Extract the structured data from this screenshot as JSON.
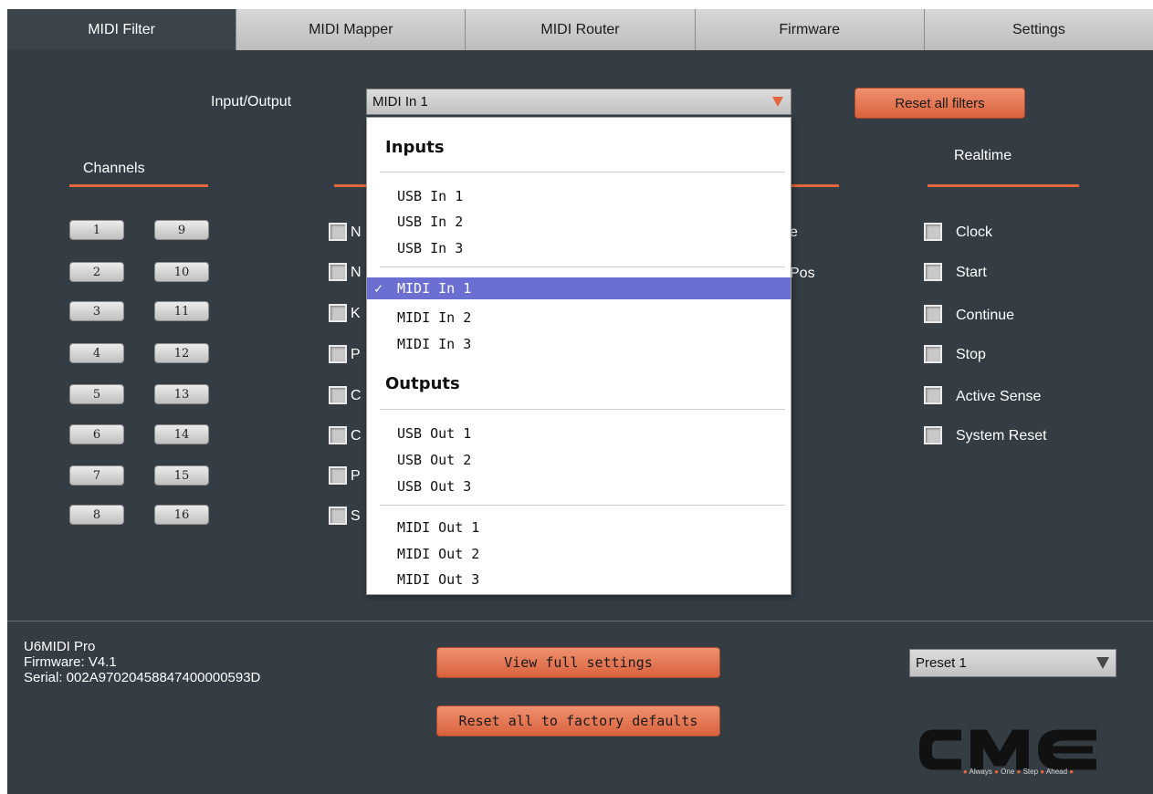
{
  "tabs": [
    "MIDI Filter",
    "MIDI Mapper",
    "MIDI Router",
    "Firmware",
    "Settings"
  ],
  "io": {
    "label": "Input/Output",
    "selected": "MIDI In 1",
    "reset_button": "Reset all filters"
  },
  "sections": {
    "channels": "Channels",
    "realtime": "Realtime"
  },
  "channels": [
    "1",
    "2",
    "3",
    "4",
    "5",
    "6",
    "7",
    "8",
    "9",
    "10",
    "11",
    "12",
    "13",
    "14",
    "15",
    "16"
  ],
  "voice_fragments": [
    "N",
    "N",
    "K",
    "P",
    "C",
    "C",
    "P",
    "S"
  ],
  "system_fragments": [
    "e",
    "Pos"
  ],
  "realtime_items": [
    "Clock",
    "Start",
    "Continue",
    "Stop",
    "Active Sense",
    "System Reset"
  ],
  "dropdown": {
    "inputs_header": "Inputs",
    "outputs_header": "Outputs",
    "usb_in": [
      "USB In 1",
      "USB In 2",
      "USB In 3"
    ],
    "selected_mark": "✓",
    "midi_in_selected": "MIDI In 1",
    "midi_in": [
      "MIDI In 2",
      "MIDI In 3"
    ],
    "usb_out": [
      "USB Out 1",
      "USB Out 2",
      "USB Out 3"
    ],
    "midi_out": [
      "MIDI Out 1",
      "MIDI Out 2",
      "MIDI Out 3"
    ]
  },
  "device": {
    "name": "U6MIDI Pro",
    "firmware": "Firmware: V4.1",
    "serial": "Serial: 002A97020458847400000593D"
  },
  "buttons": {
    "view_full_settings": "View full settings",
    "reset_factory": "Reset all to factory defaults"
  },
  "preset": {
    "selected": "Preset 1"
  },
  "logo": {
    "text": "CME",
    "tagline": [
      "Always",
      "One",
      "Step",
      "Ahead"
    ]
  },
  "colors": {
    "background": "#343d44",
    "accent": "#e5663c",
    "selection": "#6b6fd1"
  }
}
